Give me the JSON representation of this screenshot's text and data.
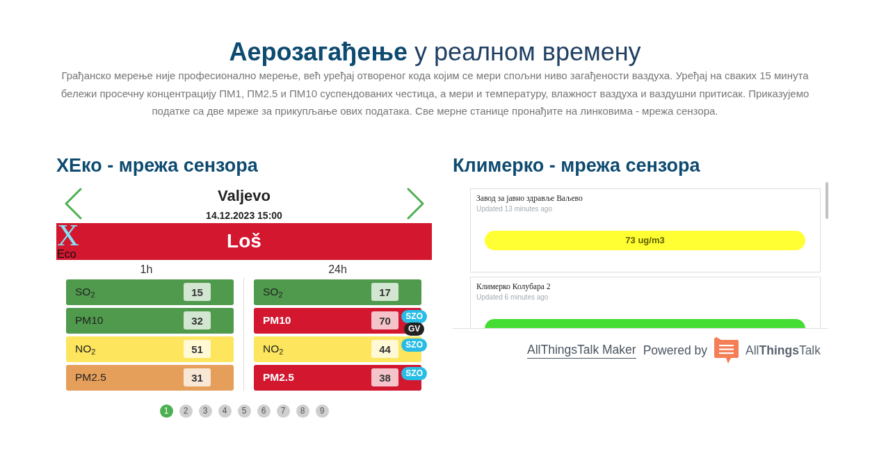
{
  "header": {
    "title": "**Аерозагађење** у реалном времену",
    "intro": "Грађанско мерење није професионално мерење, већ уређај отвореног кода којим се мери спољни ниво загађености ваздуха. Уређај на сваких 15 минута бележи просечну концентрацију ПМ1, ПМ2.5 и ПМ10 суспендованих честица, а мери и температуру, влажност ваздуха и ваздушни притисак. Приказујемо податке са две мреже за прикупљање ових података. Све мерне станице пронађите на линковима - мрежа сензора."
  },
  "left_panel": {
    "title": "ХЕко - мрежа сензора",
    "station": "Valjevo",
    "timestamp": "14.12.2023 15:00",
    "logo": {
      "mark": "X",
      "text": "Eco"
    },
    "status": {
      "label": "Loš",
      "color": "#d2172f"
    },
    "periods": [
      {
        "label": "1h",
        "readings": [
          {
            "pollutant": "SO$_{2}$",
            "value": "15",
            "color": "#4f9a4c"
          },
          {
            "pollutant": "PM10",
            "value": "32",
            "color": "#4f9a4c"
          },
          {
            "pollutant": "NO$_{2}$",
            "value": "51",
            "color": "#fde65e"
          },
          {
            "pollutant": "PM2.5",
            "value": "31",
            "color": "#e69f5b"
          }
        ]
      },
      {
        "label": "24h",
        "readings": [
          {
            "pollutant": "SO$_{2}$",
            "value": "17",
            "color": "#4f9a4c"
          },
          {
            "pollutant": "PM10",
            "value": "70",
            "color": "#d2172f",
            "badges": [
              {
                "label": "SZO",
                "color": "#29bde6"
              },
              {
                "label": "GV",
                "color": "#222222"
              }
            ]
          },
          {
            "pollutant": "NO$_{2}$",
            "value": "44",
            "color": "#fde65e",
            "badges": [
              {
                "label": "SZO",
                "color": "#29bde6"
              }
            ]
          },
          {
            "pollutant": "PM2.5",
            "value": "38",
            "color": "#d2172f",
            "badges": [
              {
                "label": "SZO",
                "color": "#29bde6"
              }
            ]
          }
        ]
      }
    ],
    "pages": [
      {
        "label": "1",
        "selected": true
      },
      {
        "label": "2",
        "selected": false
      },
      {
        "label": "3",
        "selected": false
      },
      {
        "label": "4",
        "selected": false
      },
      {
        "label": "5",
        "selected": false
      },
      {
        "label": "6",
        "selected": false
      },
      {
        "label": "7",
        "selected": false
      },
      {
        "label": "8",
        "selected": false
      },
      {
        "label": "9",
        "selected": false
      }
    ]
  },
  "right_panel": {
    "title": "Климерко - мрежа сензора",
    "stations": [
      {
        "name": "Завод за јавно здравље Ваљево",
        "updated": "Updated 13 minutes ago",
        "reading": "73 ug/m3",
        "color": "#ffff33"
      },
      {
        "name": "Климерко Колубара 2",
        "updated": "Updated 6 minutes ago",
        "color": "#44dd33"
      }
    ],
    "footer": {
      "link": "AllThingsTalk Maker",
      "powered": "Powered by",
      "brand": "All**Things**Talk"
    }
  }
}
